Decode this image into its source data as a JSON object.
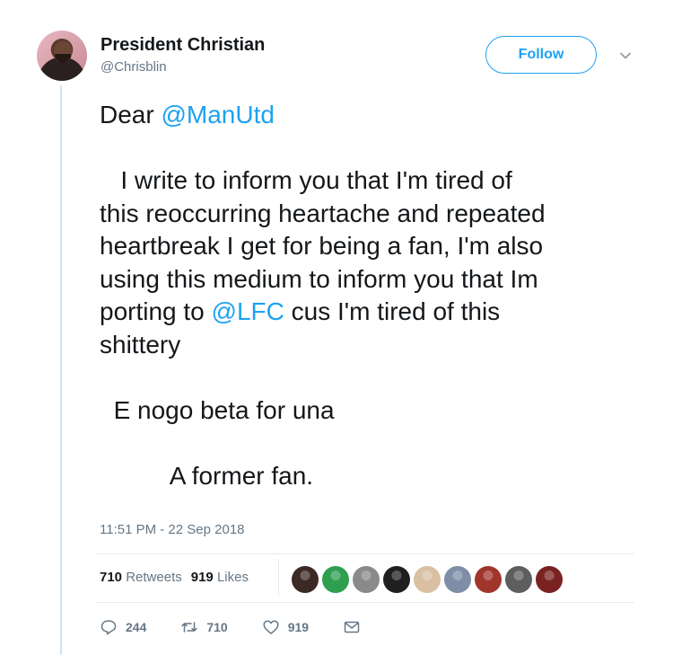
{
  "user": {
    "display_name": "President Christian",
    "handle": "@Chrisblin",
    "follow_label": "Follow"
  },
  "tweet": {
    "line1_prefix": "Dear ",
    "line1_mention": "@ManUtd",
    "para1_part1": "   I write to inform you that I'm tired of\nthis reoccurring heartache and repeated\nheartbreak I get for being a fan, I'm also\nusing this medium to inform you that Im\nporting to ",
    "para1_mention": "@LFC",
    "para1_part2": " cus I'm tired of this\nshittery",
    "line_pidgin": "  E nogo beta for una",
    "signoff": "          A former fan.",
    "timestamp": "11:51 PM - 22 Sep 2018"
  },
  "stats": {
    "retweets_count": "710",
    "retweets_label": "Retweets",
    "likes_count": "919",
    "likes_label": "Likes",
    "liker_avatar_colors": [
      "#3b2a24",
      "#2e9e4f",
      "#8a8a8a",
      "#1f1f1f",
      "#d9c0a3",
      "#7d8ea6",
      "#a0352b",
      "#5e5e5e",
      "#7a2222"
    ]
  },
  "actions": {
    "replies": "244",
    "retweets": "710",
    "likes": "919"
  },
  "colors": {
    "accent": "#1da1f2",
    "muted": "#657786",
    "text": "#14171a"
  },
  "icons": [
    "chevron-down-icon",
    "reply-icon",
    "retweet-icon",
    "heart-icon",
    "envelope-icon"
  ]
}
